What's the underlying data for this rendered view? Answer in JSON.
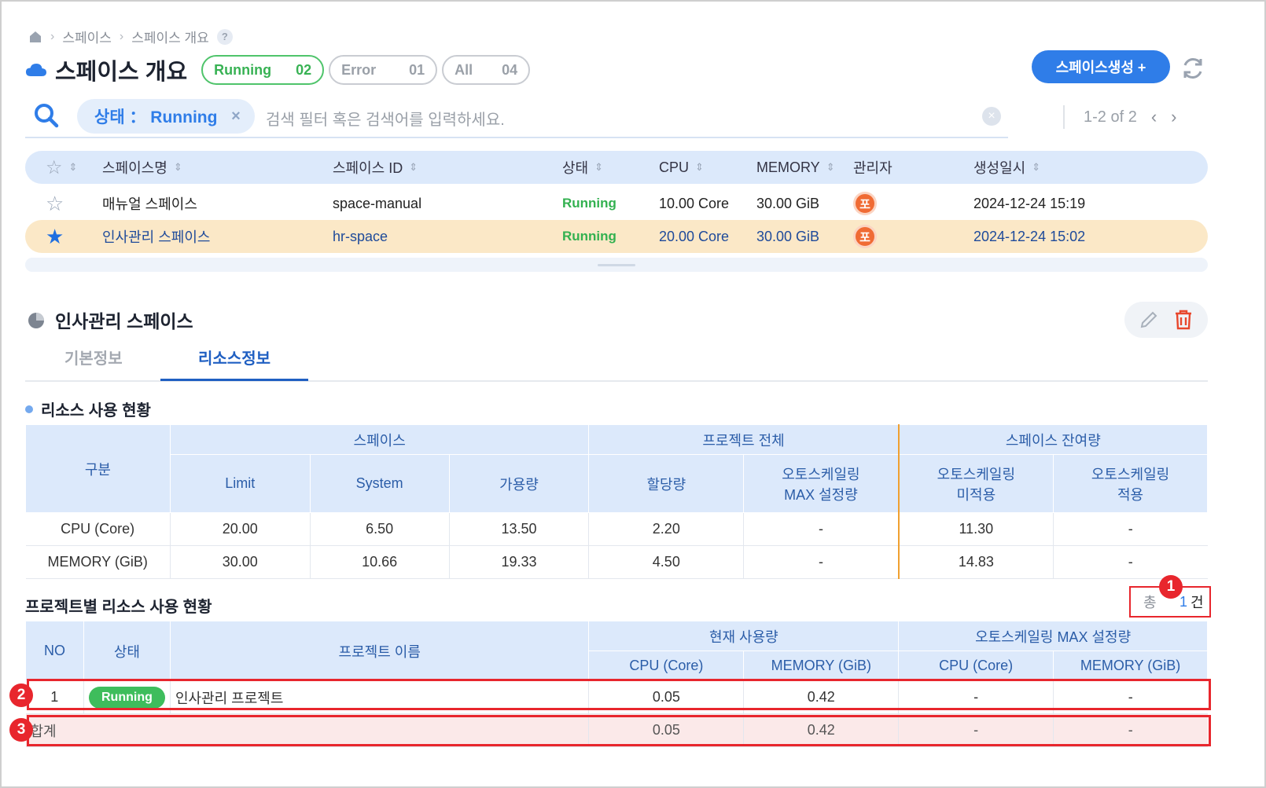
{
  "breadcrumb": {
    "items": [
      "스페이스",
      "스페이스 개요"
    ],
    "help": "?"
  },
  "header": {
    "title": "스페이스 개요",
    "filters": [
      {
        "label": "Running",
        "count": "02"
      },
      {
        "label": "Error",
        "count": "01"
      },
      {
        "label": "All",
        "count": "04"
      }
    ],
    "create_label": "스페이스생성 +"
  },
  "search": {
    "chip_label": "상태 ： Running",
    "chip_close": "×",
    "placeholder": "검색 필터 혹은 검색어를 입력하세요.",
    "clear": "×",
    "pager": "1-2 of 2",
    "prev": "‹",
    "next": "›"
  },
  "list": {
    "columns": [
      "스페이스명",
      "스페이스 ID",
      "상태",
      "CPU",
      "MEMORY",
      "관리자",
      "생성일시"
    ],
    "rows": [
      {
        "name": "매뉴얼 스페이스",
        "id": "space-manual",
        "status": "Running",
        "cpu": "10.00 Core",
        "memory": "30.00 GiB",
        "admin": "포",
        "created": "2024-12-24 15:19",
        "starred": false
      },
      {
        "name": "인사관리 스페이스",
        "id": "hr-space",
        "status": "Running",
        "cpu": "20.00 Core",
        "memory": "30.00 GiB",
        "admin": "포",
        "created": "2024-12-24 15:02",
        "starred": true
      }
    ]
  },
  "detail": {
    "title": "인사관리 스페이스",
    "tabs": [
      "기본정보",
      "리소스정보"
    ],
    "active_tab": "리소스정보"
  },
  "resource_usage": {
    "title": "리소스 사용 현황",
    "group_headers": [
      "구분",
      "스페이스",
      "프로젝트 전체",
      "스페이스 잔여량"
    ],
    "sub_headers": [
      "Limit",
      "System",
      "가용량",
      "할당량",
      "오토스케일링 MAX 설정량",
      "오토스케일링 미적용",
      "오토스케일링 적용"
    ],
    "rows": [
      {
        "label": "CPU (Core)",
        "values": [
          "20.00",
          "6.50",
          "13.50",
          "2.20",
          "-",
          "11.30",
          "-"
        ]
      },
      {
        "label": "MEMORY (GiB)",
        "values": [
          "30.00",
          "10.66",
          "19.33",
          "4.50",
          "-",
          "14.83",
          "-"
        ]
      }
    ]
  },
  "project_usage": {
    "title": "프로젝트별 리소스 사용 현황",
    "total_label": "총",
    "total_count": "1",
    "total_unit": "건",
    "headers": [
      "NO",
      "상태",
      "프로젝트 이름",
      "현재 사용량",
      "오토스케일링 MAX 설정량"
    ],
    "sub_headers": [
      "CPU (Core)",
      "MEMORY (GiB)",
      "CPU (Core)",
      "MEMORY (GiB)"
    ],
    "rows": [
      {
        "no": "1",
        "status": "Running",
        "name": "인사관리 프로젝트",
        "values": [
          "0.05",
          "0.42",
          "-",
          "-"
        ]
      }
    ],
    "sum": {
      "label": "합계",
      "values": [
        "0.05",
        "0.42",
        "-",
        "-"
      ]
    }
  },
  "annotations": [
    "1",
    "2",
    "3"
  ],
  "colors": {
    "accent": "#2f7de8",
    "running": "#3ebd5c",
    "highlight": "#e8262d",
    "selected_row": "#fbe8c7"
  }
}
